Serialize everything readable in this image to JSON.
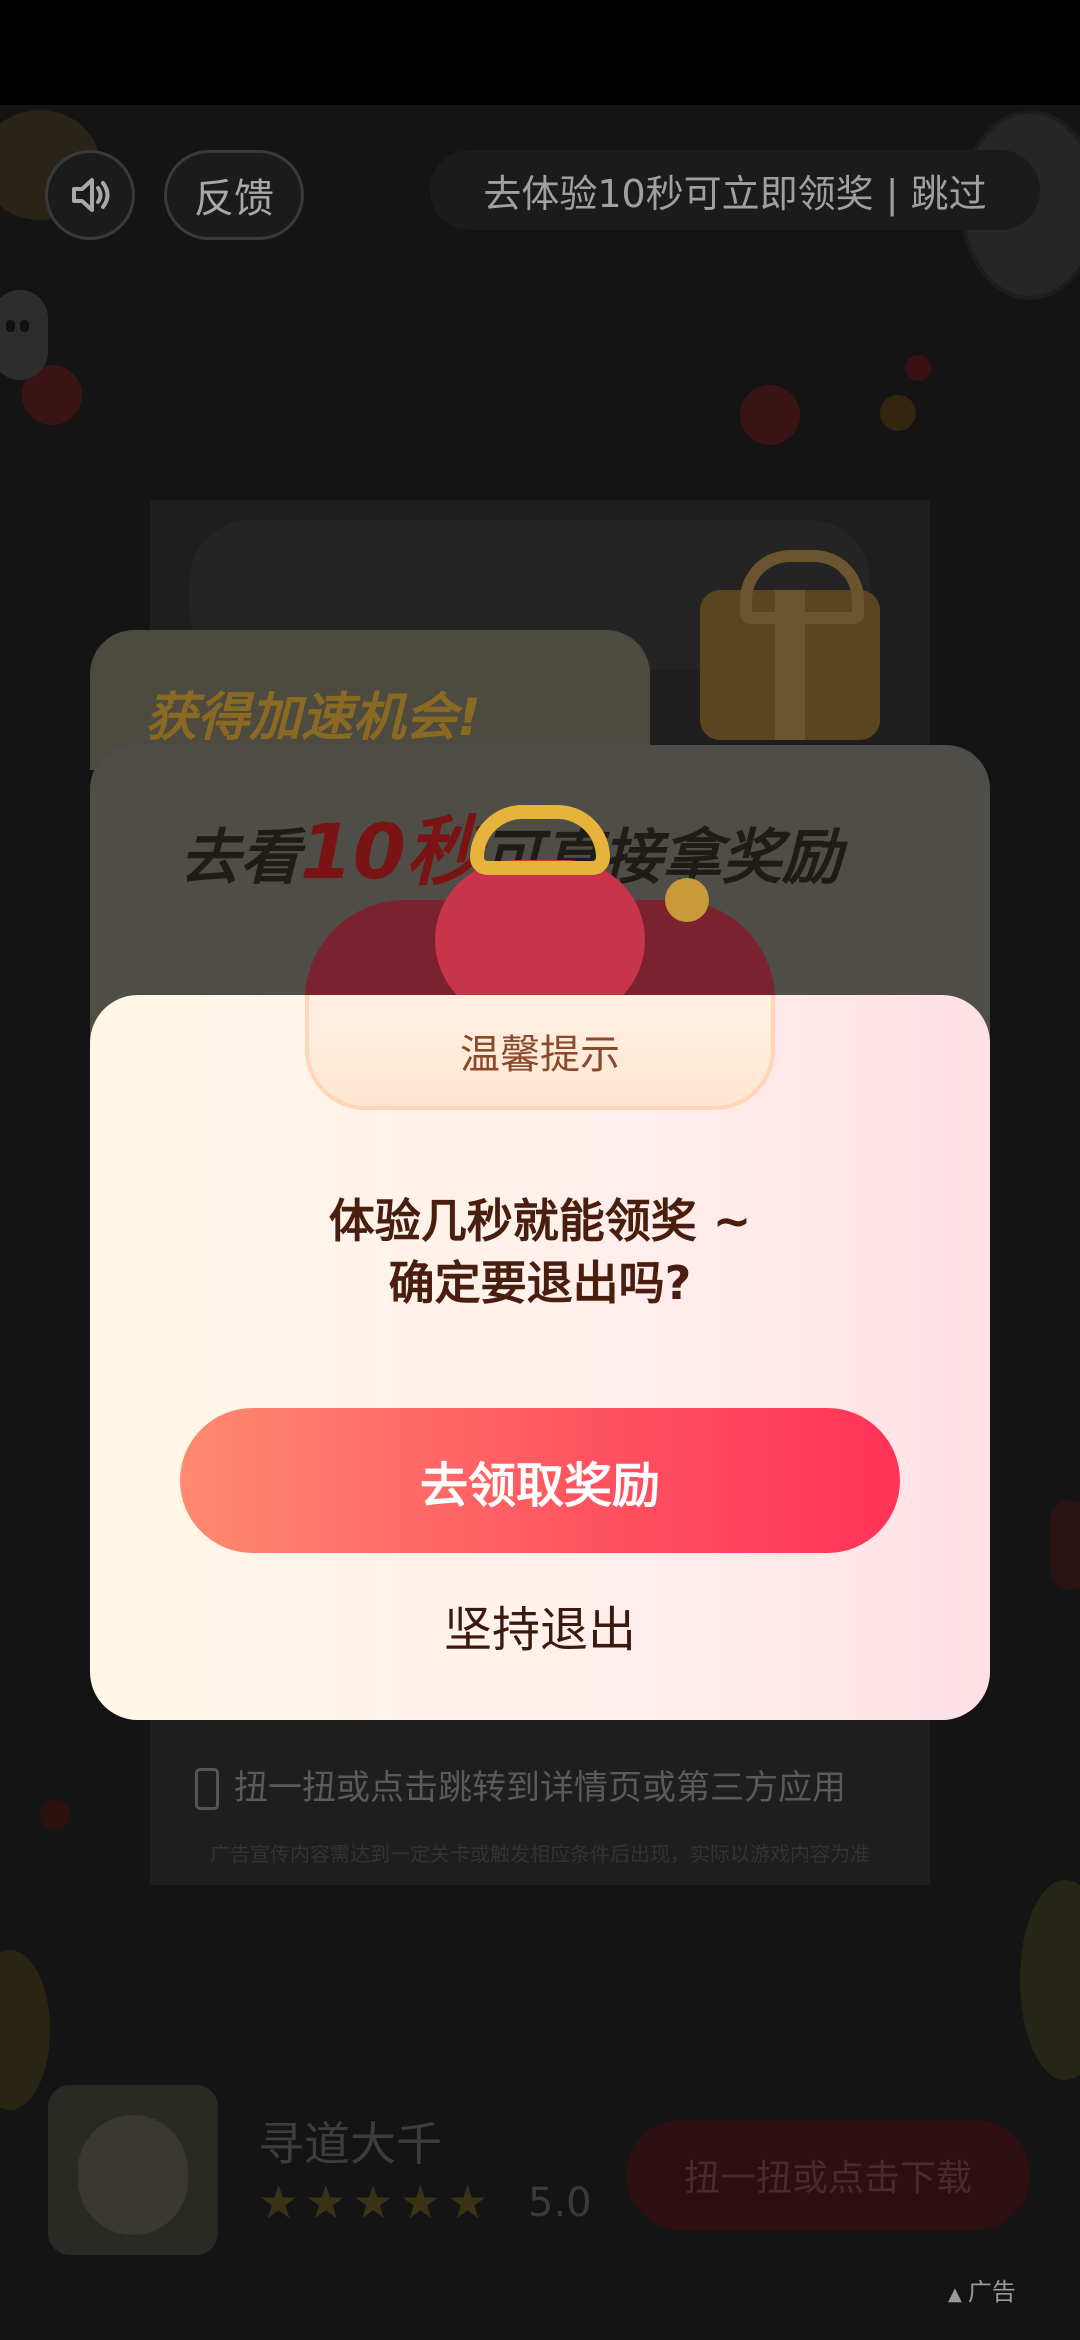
{
  "top_bar": {
    "feedback_label": "反馈",
    "skip_text": "去体验10秒可立即领奖 | 跳过",
    "sound_icon": "speaker-icon"
  },
  "ad": {
    "action_hint": "扭一扭或点击跳转到详情页或第三方应用",
    "disclaimer": "广告宣传内容需达到一定关卡或触发相应条件后出现，实际以游戏内容为准",
    "ad_tag": "广告"
  },
  "promo": {
    "title": "获得加速机会!",
    "subtitle_prefix": "去看",
    "subtitle_highlight": "10秒",
    "subtitle_suffix": "可直接拿奖励"
  },
  "app": {
    "name": "寻道大千",
    "stars": "★★★★★",
    "rating": "5.0",
    "download_label": "扭一扭或点击下载"
  },
  "modal": {
    "tab_title": "温馨提示",
    "message_line1": "体验几秒就能领奖 ~",
    "message_line2": "确定要退出吗?",
    "primary_button": "去领取奖励",
    "secondary_button": "坚持退出"
  },
  "colors": {
    "primary_gradient_start": "#ff8a70",
    "primary_gradient_end": "#ff3358",
    "modal_text": "#4a1e0e",
    "tab_text": "#8a4a2c"
  }
}
